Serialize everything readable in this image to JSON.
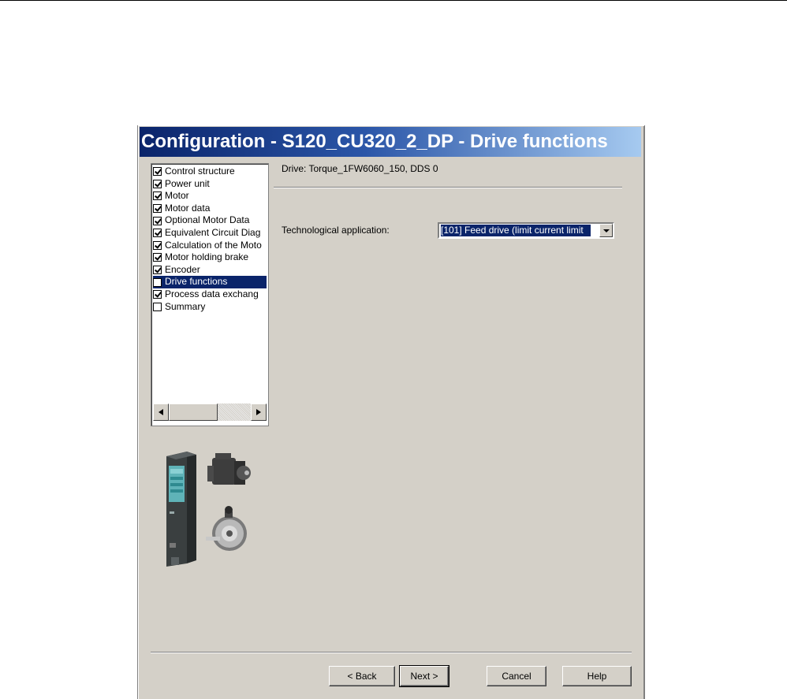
{
  "window": {
    "title": "Configuration - S120_CU320_2_DP - Drive functions"
  },
  "tree": {
    "items": [
      {
        "label": "Control structure",
        "checked": true,
        "selected": false
      },
      {
        "label": "Power unit",
        "checked": true,
        "selected": false
      },
      {
        "label": "Motor",
        "checked": true,
        "selected": false
      },
      {
        "label": "Motor data",
        "checked": true,
        "selected": false
      },
      {
        "label": "Optional Motor Data",
        "checked": true,
        "selected": false
      },
      {
        "label": "Equivalent Circuit Diag",
        "checked": true,
        "selected": false
      },
      {
        "label": "Calculation of the Moto",
        "checked": true,
        "selected": false
      },
      {
        "label": "Motor holding brake",
        "checked": true,
        "selected": false
      },
      {
        "label": "Encoder",
        "checked": true,
        "selected": false
      },
      {
        "label": "Drive functions",
        "checked": false,
        "selected": true
      },
      {
        "label": "Process data exchang",
        "checked": true,
        "selected": false
      },
      {
        "label": "Summary",
        "checked": false,
        "selected": false
      }
    ]
  },
  "main": {
    "drive_header": "Drive: Torque_1FW6060_150, DDS 0",
    "tech_label": "Technological application:",
    "tech_value": "[101] Feed drive (limit current limit"
  },
  "buttons": {
    "back": "< Back",
    "next": "Next >",
    "cancel": "Cancel",
    "help": "Help"
  },
  "colors": {
    "title_start": "#0a246a",
    "title_end": "#a6caf0",
    "selection": "#0a246a",
    "face": "#d4d0c8"
  },
  "icons": {
    "scroll_left": "triangle-left",
    "scroll_right": "triangle-right",
    "dropdown": "triangle-down"
  }
}
